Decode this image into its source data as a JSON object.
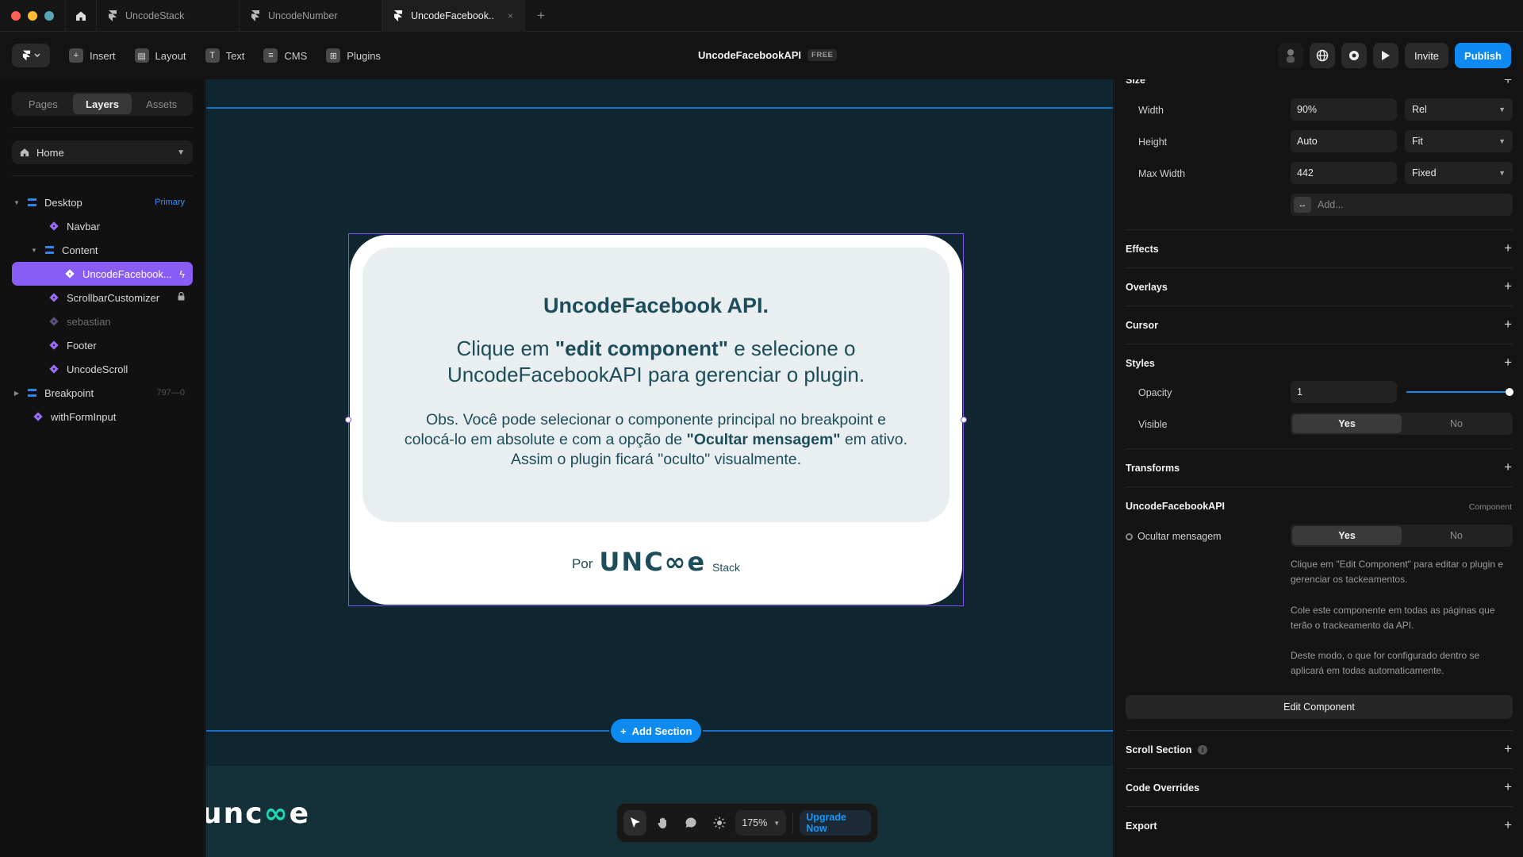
{
  "tabs": {
    "home_icon": "home-icon",
    "items": [
      {
        "label": "UncodeStack"
      },
      {
        "label": "UncodeNumber"
      },
      {
        "label": "UncodeFacebook.."
      }
    ],
    "close_glyph": "×",
    "add_glyph": "+"
  },
  "toolbar": {
    "insert": "Insert",
    "layout": "Layout",
    "text": "Text",
    "cms": "CMS",
    "plugins": "Plugins",
    "doc_title": "UncodeFacebookAPI",
    "plan_badge": "FREE",
    "invite": "Invite",
    "publish": "Publish"
  },
  "left_panel": {
    "tabs": [
      "Pages",
      "Layers",
      "Assets"
    ],
    "active_tab": "Layers",
    "page_select": "Home",
    "layers": [
      {
        "label": "Desktop",
        "tag": "Primary"
      },
      {
        "label": "Navbar"
      },
      {
        "label": "Content"
      },
      {
        "label": "UncodeFacebook..."
      },
      {
        "label": "ScrollbarCustomizer"
      },
      {
        "label": "sebastian"
      },
      {
        "label": "Footer"
      },
      {
        "label": "UncodeScroll"
      },
      {
        "label": "Breakpoint",
        "tag": "797—0"
      },
      {
        "label": "withFormInput"
      }
    ]
  },
  "canvas": {
    "card_title": "UncodeFacebook API.",
    "card_main_pre": "Clique em ",
    "card_main_bold": "\"edit component\"",
    "card_main_post": " e selecione o UncodeFacebookAPI para gerenciar o plugin.",
    "card_note_pre": "Obs. Você pode selecionar o componente principal no breakpoint e colocá-lo em absolute e com a opção de ",
    "card_note_bold": "\"Ocultar mensagem\"",
    "card_note_post": " em ativo. Assim o plugin ficará \"oculto\" visualmente.",
    "card_by": "Por",
    "card_logo": "UNC∞e",
    "card_logo_sub": "Stack",
    "add_section": "Add Section",
    "footer_logo_a": "unc",
    "footer_logo_b": "∞",
    "footer_logo_c": "e"
  },
  "bottom_bar": {
    "zoom": "175%",
    "upgrade": "Upgrade Now"
  },
  "right_panel": {
    "size_title": "Size",
    "width_label": "Width",
    "width_value": "90%",
    "width_mode": "Rel",
    "height_label": "Height",
    "height_value": "Auto",
    "height_mode": "Fit",
    "maxwidth_label": "Max Width",
    "maxwidth_value": "442",
    "maxwidth_mode": "Fixed",
    "add_placeholder": "Add...",
    "effects": "Effects",
    "overlays": "Overlays",
    "cursor": "Cursor",
    "styles": "Styles",
    "opacity_label": "Opacity",
    "opacity_value": "1",
    "opacity_fraction": 1.0,
    "visible_label": "Visible",
    "yes": "Yes",
    "no": "No",
    "transforms": "Transforms",
    "component_title": "UncodeFacebookAPI",
    "component_tag": "Component",
    "ocultar_label": "Ocultar mensagem",
    "help_1": "Clique em \"Edit Component\" para editar o plugin e gerenciar os tackeamentos.",
    "help_2": "Cole este componente em todas as páginas que terão o trackeamento da API.",
    "help_3": "Deste modo, o que for configurado dentro se aplicará em todas automaticamente.",
    "edit_component": "Edit Component",
    "scroll_section": "Scroll Section",
    "code_overrides": "Code Overrides",
    "export": "Export"
  },
  "colors": {
    "accent_blue": "#0d8bf2",
    "selection_purple": "#8a5cf6",
    "canvas_bg": "#0f2630",
    "brand_teal": "#1fd8b5"
  }
}
